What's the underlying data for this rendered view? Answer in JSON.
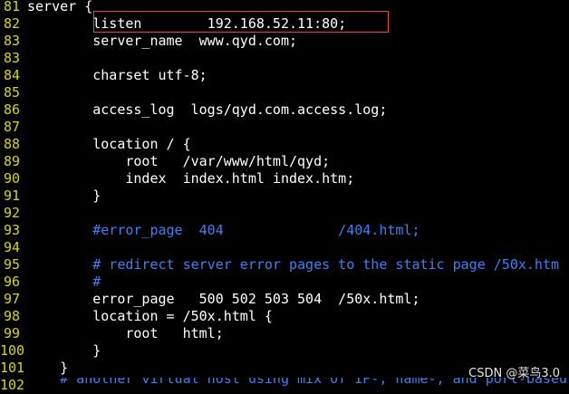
{
  "colors": {
    "background": "#000000",
    "line_number": "#d7d700",
    "code": "#ffffff",
    "comment": "#3a82f7",
    "highlight_box": "#e8414b"
  },
  "lines": [
    {
      "num": "81",
      "text": "server {",
      "comment": false
    },
    {
      "num": "82",
      "text": "        listen        192.168.52.11:80;",
      "comment": false
    },
    {
      "num": "83",
      "text": "        server_name  www.qyd.com;",
      "comment": false
    },
    {
      "num": "83",
      "text": "",
      "comment": false
    },
    {
      "num": "84",
      "text": "        charset utf-8;",
      "comment": false
    },
    {
      "num": "85",
      "text": "",
      "comment": false
    },
    {
      "num": "86",
      "text": "        access_log  logs/qyd.com.access.log;",
      "comment": false
    },
    {
      "num": "87",
      "text": "",
      "comment": false
    },
    {
      "num": "88",
      "text": "        location / {",
      "comment": false
    },
    {
      "num": "89",
      "text": "            root   /var/www/html/qyd;",
      "comment": false
    },
    {
      "num": "90",
      "text": "            index  index.html index.htm;",
      "comment": false
    },
    {
      "num": "91",
      "text": "        }",
      "comment": false
    },
    {
      "num": "92",
      "text": "",
      "comment": false
    },
    {
      "num": "93",
      "text": "        #error_page  404              /404.html;",
      "comment": true
    },
    {
      "num": "94",
      "text": "",
      "comment": false
    },
    {
      "num": "95",
      "text": "        # redirect server error pages to the static page /50x.htm",
      "comment": true
    },
    {
      "num": "96",
      "text": "        #",
      "comment": true
    },
    {
      "num": "97",
      "text": "        error_page   500 502 503 504  /50x.html;",
      "comment": false
    },
    {
      "num": "98",
      "text": "        location = /50x.html {",
      "comment": false
    },
    {
      "num": "99",
      "text": "            root   html;",
      "comment": false
    },
    {
      "num": "100",
      "text": "        }",
      "comment": false
    },
    {
      "num": "101",
      "text": "    }",
      "comment": false
    },
    {
      "num": "102",
      "text": "",
      "comment": false
    }
  ],
  "partial_line": "    # another virtual host using mix of IP-, name-, and port-based",
  "watermark": "CSDN @菜鸟3.0"
}
